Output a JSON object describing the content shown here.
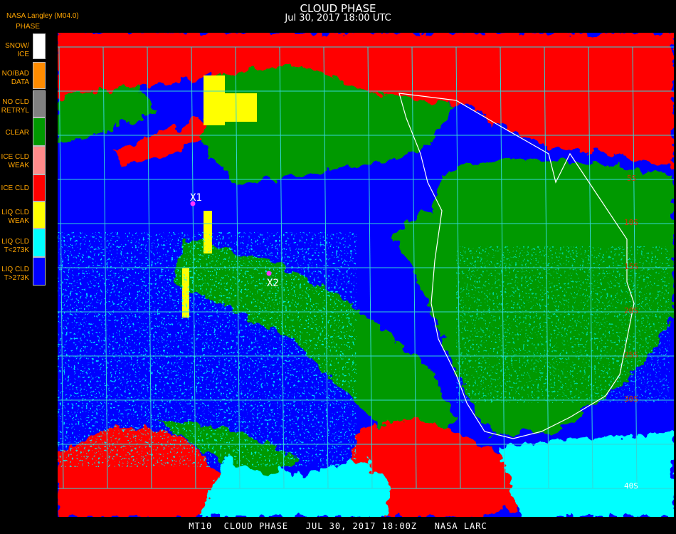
{
  "header": {
    "title": "CLOUD PHASE",
    "datetime": "Jul 30, 2017 18:00 UTC"
  },
  "product_id": "NASA Langley (M04.0)",
  "legend": {
    "title": "PHASE",
    "items": [
      {
        "label": "SNOW/\nICE",
        "color": "#ffffff"
      },
      {
        "label": "NO/BAD\nDATA",
        "color": "#ff8c00"
      },
      {
        "label": "NO CLD\nRETRYL",
        "color": "#808080"
      },
      {
        "label": "CLEAR",
        "color": "#009900"
      },
      {
        "label": "ICE CLD\nWEAK",
        "color": "#ff8a8a"
      },
      {
        "label": "ICE CLD",
        "color": "#ff0000"
      },
      {
        "label": "LIQ CLD\nWEAK",
        "color": "#ffff00"
      },
      {
        "label": "LIQ CLD\nT<273K",
        "color": "#00ffff"
      },
      {
        "label": "LIQ CLD\nT>273K",
        "color": "#0000ff"
      }
    ]
  },
  "map": {
    "markers": [
      {
        "label": "X1",
        "color": "#ff33ff"
      },
      {
        "label": "X2",
        "color": "#ff33ff"
      }
    ],
    "lat_labels": [
      "5S",
      "10S",
      "15S",
      "20S",
      "25S",
      "30S",
      "40S"
    ],
    "grid_color": "#33d6d6",
    "coast_color": "#ffffff",
    "lat_label_color": "#cc3300"
  },
  "footer": {
    "text": "MT10  CLOUD PHASE   JUL 30, 2017 18:00Z   NASA LARC"
  }
}
